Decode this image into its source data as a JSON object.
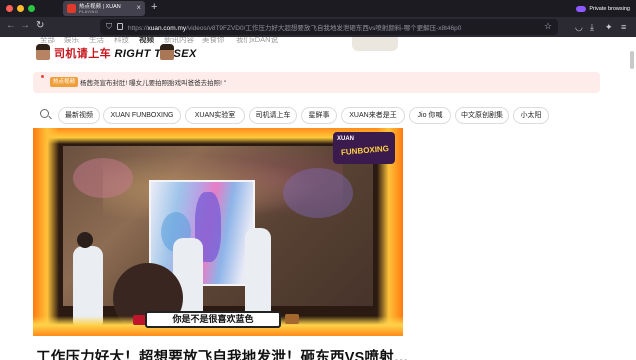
{
  "browser": {
    "tab": {
      "title": "热点视频 | XUAN",
      "subtitle": "PLAYING"
    },
    "new_tab": "+",
    "private_label": "Private browsing",
    "url": {
      "host": "xuan.com.my",
      "prefix": "https://",
      "path": "/videos/v8T9FZVD0/工作压力好大超想要放飞自我地发泄砸东西vs喷射颜料-哪个更解压-x8t46p0"
    },
    "nav": {
      "back": "←",
      "forward": "→",
      "reload": "↻"
    }
  },
  "page": {
    "categories": [
      "全部",
      "娱乐",
      "生活",
      "科技",
      "视频",
      "新讯内容",
      "美食你",
      "我们xDAN说"
    ],
    "active_category": "视频",
    "show_banner": {
      "title_cn": "司机请上车",
      "title_en": "RIGHT TO SEX"
    },
    "announcement": {
      "tag": "热点视频",
      "text": "杨茜尧宣布封肚! 曝女儿要拍照胎戏叫爸爸去拍照! \""
    },
    "chips": [
      "最新视频",
      "XUAN FUNBOXING",
      "XUAN实验室",
      "司机请上车",
      "星鲜事",
      "XUAN来者是王",
      "Jio 你喊",
      "中文原创剧集",
      "小太阳"
    ],
    "video": {
      "logo_top": "XUAN",
      "logo_main": "FUNBOXING",
      "caption": "你是不是很喜欢蓝色"
    },
    "title": "工作压力好大！超想要放飞自我地发泄！砸东西VS喷射…"
  }
}
